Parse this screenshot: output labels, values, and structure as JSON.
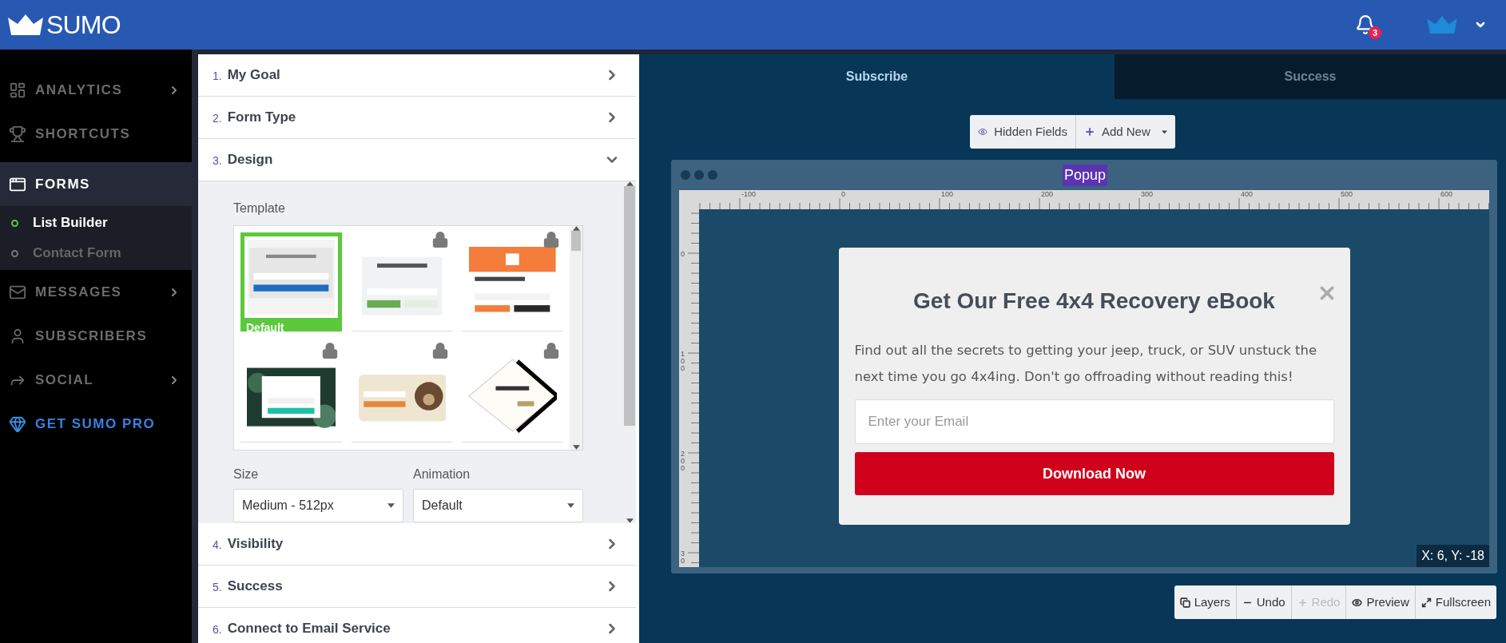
{
  "brand": "SUMO",
  "notifications": {
    "count": "3"
  },
  "sidebar": {
    "items": [
      {
        "kind": "nav",
        "label": "ANALYTICS",
        "has_submenu": true,
        "selected": false
      },
      {
        "kind": "nav",
        "label": "SHORTCUTS",
        "has_submenu": false,
        "selected": false
      },
      {
        "kind": "nav",
        "label": "FORMS",
        "has_submenu": false,
        "selected": true,
        "children": [
          {
            "label": "List Builder",
            "selected": true
          },
          {
            "label": "Contact Form",
            "selected": false
          }
        ]
      },
      {
        "kind": "nav",
        "label": "MESSAGES",
        "has_submenu": true,
        "selected": false
      },
      {
        "kind": "nav",
        "label": "SUBSCRIBERS",
        "has_submenu": false,
        "selected": false
      },
      {
        "kind": "nav",
        "label": "SOCIAL",
        "has_submenu": true,
        "selected": false
      },
      {
        "kind": "promo",
        "label": "GET SUMO PRO",
        "has_submenu": false,
        "selected": false
      }
    ]
  },
  "steps": [
    {
      "number": "1.",
      "title": "My Goal",
      "expanded": false
    },
    {
      "number": "2.",
      "title": "Form Type",
      "expanded": false
    },
    {
      "number": "3.",
      "title": "Design",
      "expanded": true
    },
    {
      "number": "4.",
      "title": "Visibility",
      "expanded": false
    },
    {
      "number": "5.",
      "title": "Success",
      "expanded": false
    },
    {
      "number": "6.",
      "title": "Connect to Email Service",
      "expanded": false
    }
  ],
  "design": {
    "template_label": "Template",
    "templates": [
      {
        "label": "Default",
        "selected": true,
        "locked": false
      },
      {
        "selected": false,
        "locked": true
      },
      {
        "selected": false,
        "locked": true
      },
      {
        "selected": false,
        "locked": true
      },
      {
        "selected": false,
        "locked": true
      },
      {
        "selected": false,
        "locked": true
      }
    ],
    "fields": [
      {
        "label": "Size",
        "value": "Medium - 512px"
      },
      {
        "label": "Animation",
        "value": "Default"
      }
    ]
  },
  "tabs": [
    {
      "label": "Subscribe",
      "selected": true
    },
    {
      "label": "Success",
      "selected": false
    }
  ],
  "toolbar": [
    {
      "label": "Hidden Fields",
      "has_dropdown": false
    },
    {
      "label": "Add New",
      "has_dropdown": true
    }
  ],
  "canvas": {
    "title": "Popup",
    "ruler": {
      "x_labels": [
        "-100",
        "0",
        "100",
        "200",
        "300",
        "400",
        "500",
        "600"
      ],
      "y_labels": [
        "0",
        "100",
        "200",
        "30"
      ]
    },
    "coordinates": "X: 6, Y: -18"
  },
  "popup": {
    "title": "Get Our Free 4x4 Recovery eBook",
    "body": "Find out all the secrets to getting your jeep, truck, or SUV unstuck the next time you go 4x4ing. Don't go offroading without reading this!",
    "email_placeholder": "Enter your Email",
    "button": "Download Now"
  },
  "bottom_tools": [
    {
      "label": "Layers",
      "disabled": false
    },
    {
      "label": "Undo",
      "disabled": false
    },
    {
      "label": "Redo",
      "disabled": true
    },
    {
      "label": "Preview",
      "disabled": false
    },
    {
      "label": "Fullscreen",
      "disabled": false
    }
  ]
}
